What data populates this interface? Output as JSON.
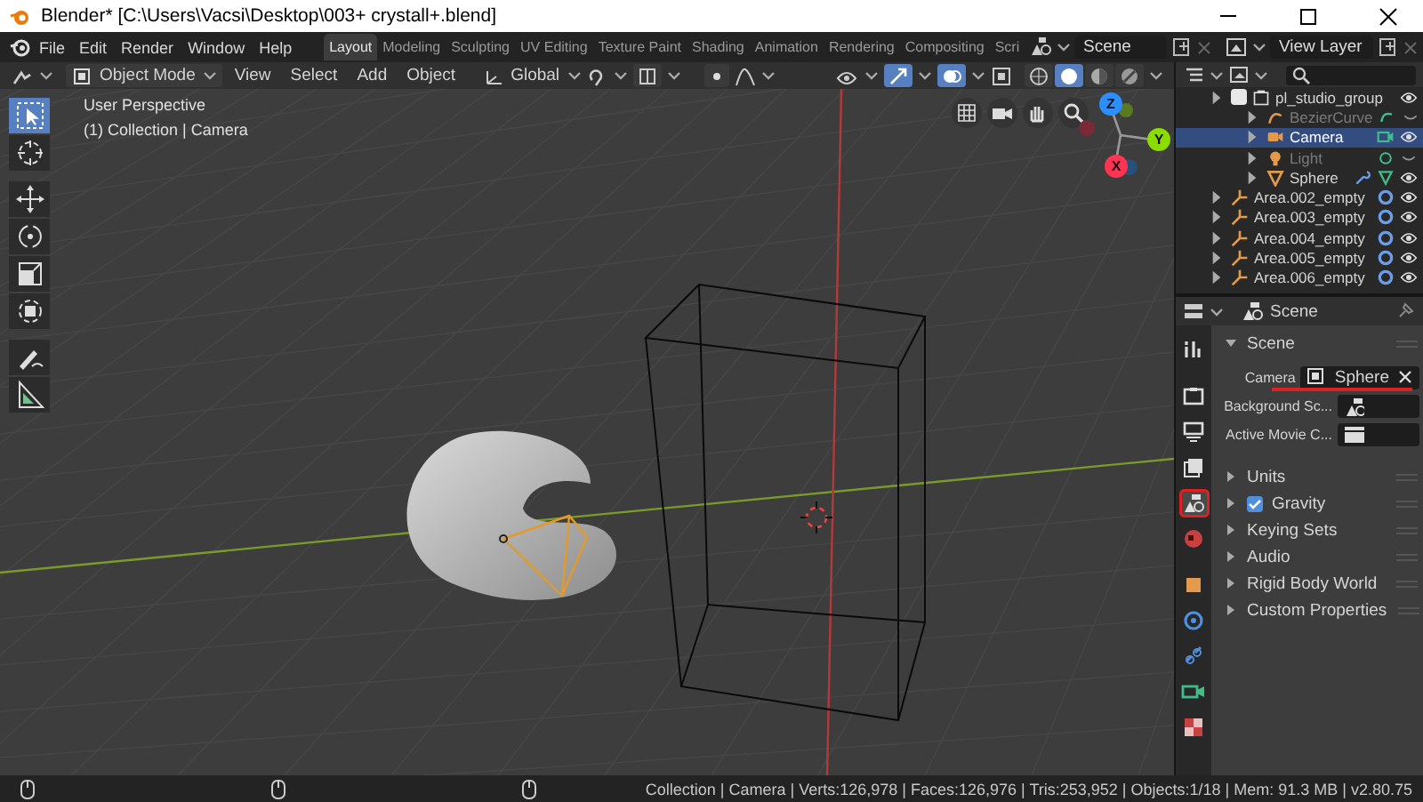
{
  "window": {
    "title": "Blender* [C:\\Users\\Vacsi\\Desktop\\003+ crystall+.blend]"
  },
  "menu": [
    "File",
    "Edit",
    "Render",
    "Window",
    "Help"
  ],
  "workspace_tabs": [
    {
      "label": "Layout",
      "selected": true
    },
    {
      "label": "Modeling",
      "selected": false
    },
    {
      "label": "Sculpting",
      "selected": false
    },
    {
      "label": "UV Editing",
      "selected": false
    },
    {
      "label": "Texture Paint",
      "selected": false
    },
    {
      "label": "Shading",
      "selected": false
    },
    {
      "label": "Animation",
      "selected": false
    },
    {
      "label": "Rendering",
      "selected": false
    },
    {
      "label": "Compositing",
      "selected": false
    },
    {
      "label": "Scri",
      "selected": false
    }
  ],
  "scene": {
    "value": "Scene"
  },
  "view_layer": {
    "value": "View Layer"
  },
  "viewport": {
    "mode": "Object Mode",
    "menus": [
      "View",
      "Select",
      "Add",
      "Object"
    ],
    "orientation": "Global",
    "shading_modes": [
      {
        "selected": false
      },
      {
        "selected": true
      },
      {
        "selected": false
      },
      {
        "selected": false
      }
    ],
    "overlay_text": [
      "User Perspective",
      "(1) Collection | Camera"
    ],
    "tools": [
      {
        "kind": "select",
        "selected": true
      },
      {
        "kind": "cursor",
        "selected": false
      },
      {
        "kind": "move",
        "selected": false
      },
      {
        "kind": "rotate",
        "selected": false
      },
      {
        "kind": "scale",
        "selected": false
      },
      {
        "kind": "transform",
        "selected": false
      },
      {
        "kind": "annotate",
        "selected": false
      },
      {
        "kind": "measure",
        "selected": false
      }
    ],
    "gizmo_labels": [
      "Z",
      "Y",
      "X"
    ]
  },
  "outliner": {
    "items": [
      {
        "name": "pl_studio_group",
        "kind": "collection",
        "checked": true,
        "selected": false,
        "visible": true,
        "children": [
          {
            "name": "BezierCurve",
            "kind": "curve",
            "selected": false,
            "visible": false
          },
          {
            "name": "Camera",
            "kind": "camera",
            "selected": true,
            "visible": true
          },
          {
            "name": "Light",
            "kind": "light",
            "selected": false,
            "visible": false
          },
          {
            "name": "Sphere",
            "kind": "mesh",
            "selected": false,
            "visible": true
          }
        ]
      },
      {
        "name": "Area.002_empty",
        "kind": "empty",
        "selected": false,
        "visible": true
      },
      {
        "name": "Area.003_empty",
        "kind": "empty",
        "selected": false,
        "visible": true
      },
      {
        "name": "Area.004_empty",
        "kind": "empty",
        "selected": false,
        "visible": true
      },
      {
        "name": "Area.005_empty",
        "kind": "empty",
        "selected": false,
        "visible": true
      },
      {
        "name": "Area.006_empty",
        "kind": "empty",
        "selected": false,
        "visible": true
      }
    ]
  },
  "properties": {
    "context": "Scene",
    "tabs": [
      {
        "kind": "tool",
        "selected": false,
        "highlighted": false
      },
      {
        "kind": "render",
        "selected": false,
        "highlighted": false
      },
      {
        "kind": "output",
        "selected": false,
        "highlighted": false
      },
      {
        "kind": "view_layer",
        "selected": false,
        "highlighted": false
      },
      {
        "kind": "scene",
        "selected": true,
        "highlighted": true
      },
      {
        "kind": "world",
        "selected": false,
        "highlighted": false
      },
      {
        "kind": "object",
        "selected": false,
        "highlighted": false
      },
      {
        "kind": "physics",
        "selected": false,
        "highlighted": false
      },
      {
        "kind": "constraints",
        "selected": false,
        "highlighted": false
      },
      {
        "kind": "camera_data",
        "selected": false,
        "highlighted": false
      },
      {
        "kind": "texture",
        "selected": false,
        "highlighted": false
      }
    ],
    "panels": [
      {
        "title": "Scene",
        "expanded": true,
        "fields": [
          {
            "label": "Camera",
            "kind": "object",
            "value": "Sphere",
            "underlined": true
          },
          {
            "label": "Background Sc...",
            "kind": "scene",
            "underlined": false
          },
          {
            "label": "Active Movie C...",
            "kind": "clip",
            "underlined": false
          }
        ]
      },
      {
        "title": "Units",
        "expanded": false
      },
      {
        "title": "Gravity",
        "expanded": false,
        "toggle": {
          "checked": true
        }
      },
      {
        "title": "Keying Sets",
        "expanded": false
      },
      {
        "title": "Audio",
        "expanded": false
      },
      {
        "title": "Rigid Body World",
        "expanded": false
      },
      {
        "title": "Custom Properties",
        "expanded": false
      }
    ]
  },
  "status_bar": {
    "text": "Collection | Camera | Verts:126,978 | Faces:126,976 | Tris:253,952 | Objects:1/18 | Mem: 91.3 MB | v2.80.75"
  }
}
